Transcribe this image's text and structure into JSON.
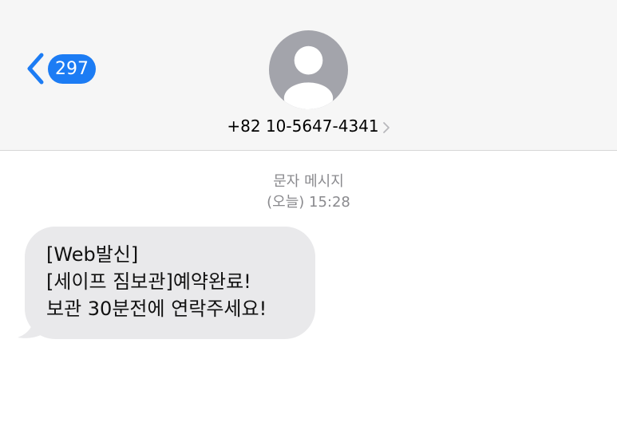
{
  "header": {
    "back_badge_count": "297",
    "contact_number": "+82 10-5647-4341"
  },
  "thread": {
    "label": "문자 메시지",
    "timestamp": "(오늘) 15:28"
  },
  "message": {
    "lines": [
      "[Web발신]",
      "[세이프 짐보관]예약완료!",
      "보관 30분전에 연락주세요!"
    ]
  },
  "icons": {
    "back": "chevron-left-icon",
    "avatar": "person-avatar-icon",
    "contact_details": "chevron-right-icon"
  },
  "colors": {
    "accent": "#1c7cf4",
    "bubble": "#e9e9eb",
    "header_bg": "#f6f6f6",
    "meta_text": "#8a8a8e"
  }
}
